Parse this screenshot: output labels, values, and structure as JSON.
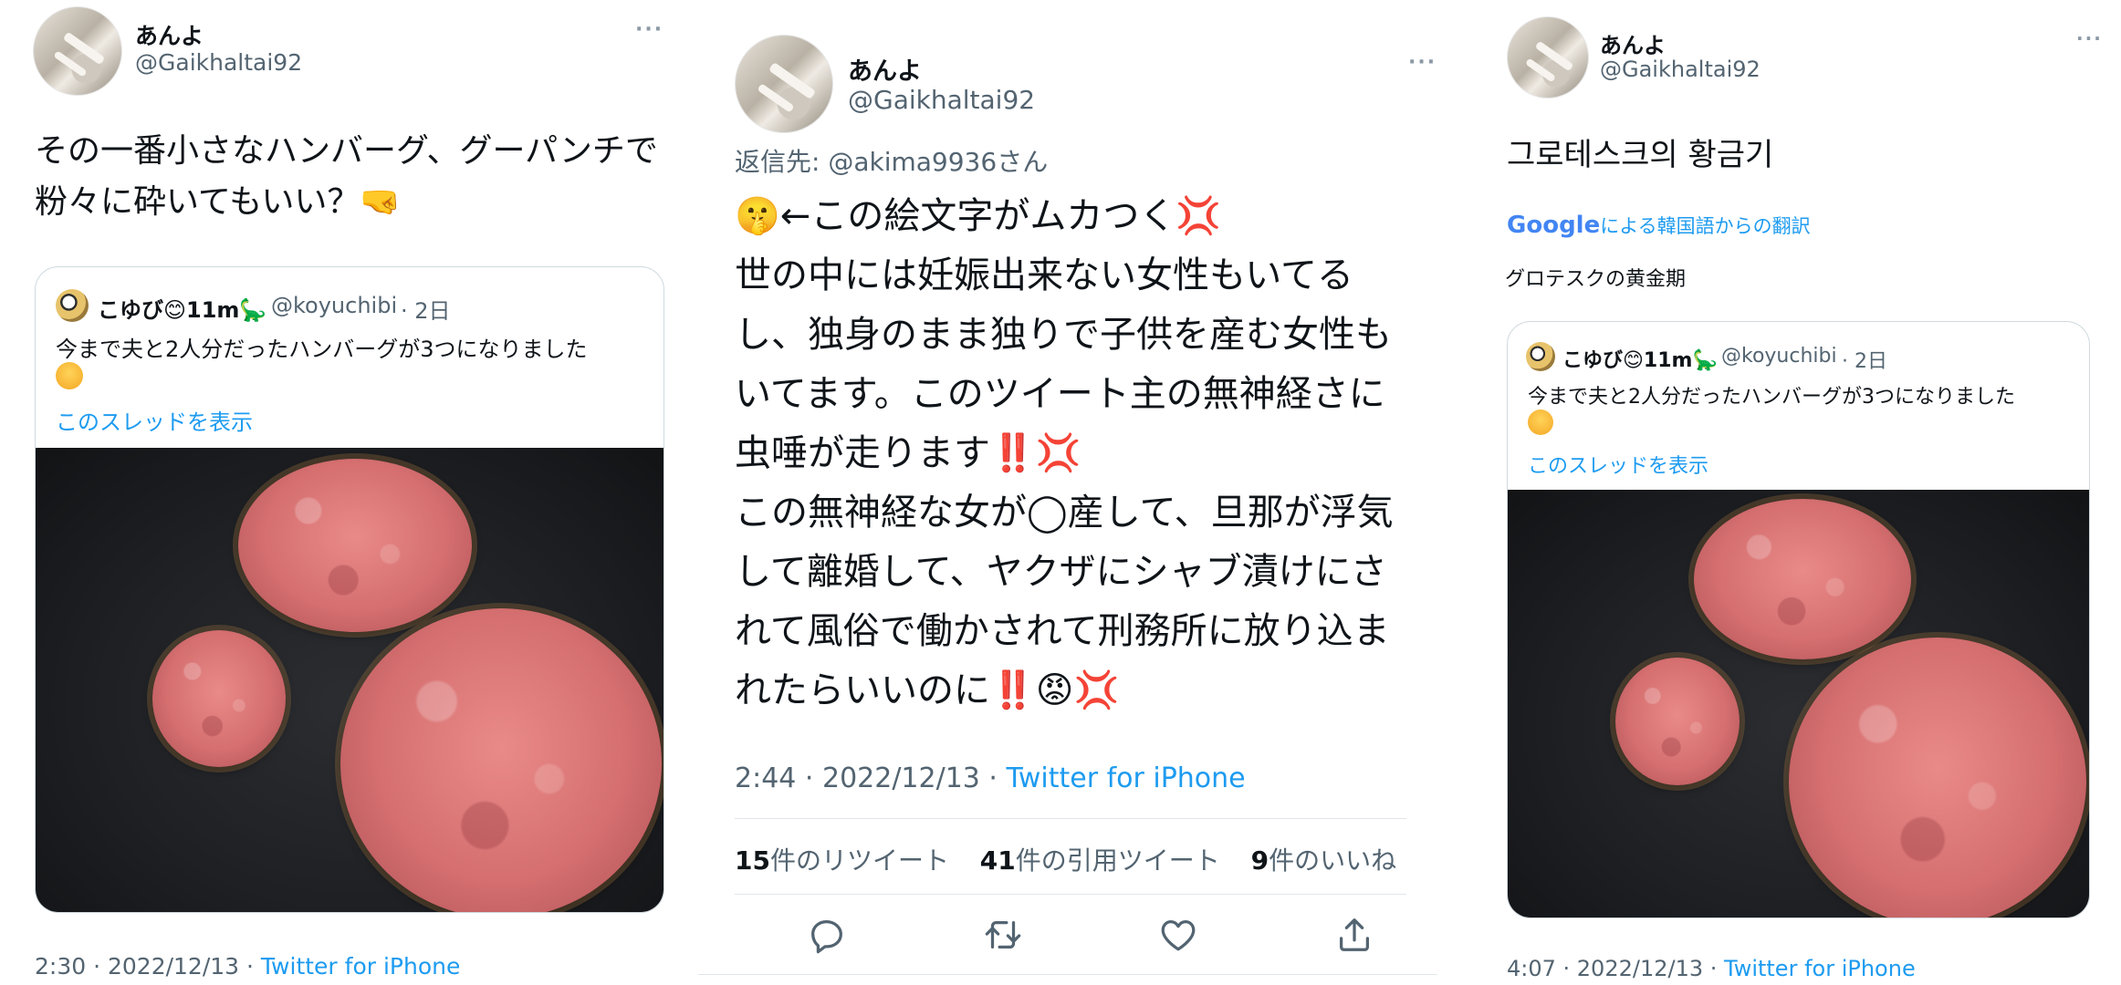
{
  "panel1": {
    "display_name": "あんよ",
    "handle": "@Gaikhaltai92",
    "more": "···",
    "tweet_text": "その一番小さなハンバーグ、グーパンチで粉々に砕いてもいい？🤜",
    "quote": {
      "display_name": "こゆび😊11m🦕",
      "handle": "@koyuchibi",
      "time": "· 2日",
      "text": "今まで夫と2人分だったハンバーグが3つになりました",
      "show_thread": "このスレッドを表示"
    },
    "timestamp": "2:30 · 2022/12/13 · ",
    "source": "Twitter for iPhone"
  },
  "panel2": {
    "display_name": "あんよ",
    "handle": "@Gaikhaltai92",
    "more": "···",
    "reply_to_prefix": "返信先: ",
    "reply_to_handle": "@akima9936さん",
    "lines": [
      "🤫←この絵文字がムカつく💢",
      "世の中には妊娠出来ない女性もいてる",
      "し、独身のまま独りで子供を産む女性も",
      "いてます。このツイート主の無神経さに",
      "虫唾が走ります‼️💢",
      "この無神経な女が◯産して、旦那が浮気",
      "して離婚して、ヤクザにシャブ漬けにさ",
      "れて風俗で働かされて刑務所に放り込ま",
      "れたらいいのに‼️😡💢"
    ],
    "timestamp": "2:44 · 2022/12/13 · ",
    "source": "Twitter for iPhone",
    "stats": {
      "retweets_count": "15",
      "retweets_label": "件のリツイート",
      "quotes_count": "41",
      "quotes_label": "件の引用ツイート",
      "likes_count": "9",
      "likes_label": "件のいいね"
    },
    "actions": [
      "reply-icon",
      "retweet-icon",
      "like-icon",
      "share-icon"
    ]
  },
  "panel3": {
    "display_name": "あんよ",
    "handle": "@Gaikhaltai92",
    "more": "···",
    "tweet_text": "그로테스크의 황금기",
    "translation_google": "Google",
    "translation_label": "による韓国語からの翻訳",
    "translation_text": "グロテスクの黄金期",
    "quote": {
      "display_name": "こゆび😊11m🦕",
      "handle": "@koyuchibi",
      "time": "· 2日",
      "text": "今まで夫と2人分だったハンバーグが3つになりました",
      "show_thread": "このスレッドを表示"
    },
    "timestamp": "4:07 · 2022/12/13 · ",
    "source": "Twitter for iPhone"
  },
  "colors": {
    "link": "#1d9bf0",
    "secondary_text": "#536471",
    "border": "#cfd9de",
    "anger_emoji": "#e0245e"
  }
}
